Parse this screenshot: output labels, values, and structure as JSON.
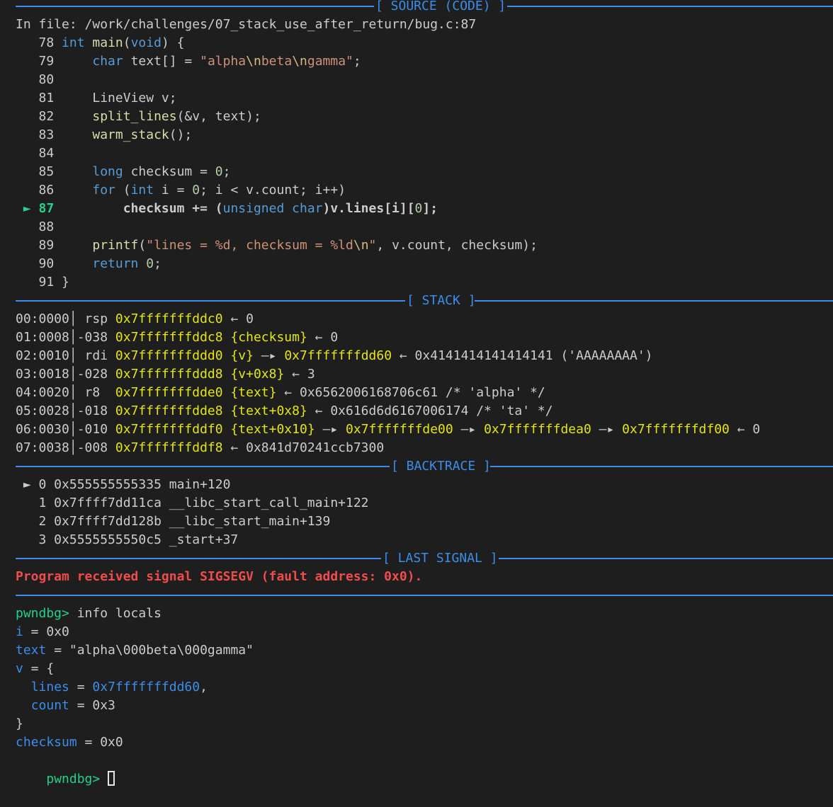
{
  "colors": {
    "background": "#1e1e1e",
    "foreground": "#cccccc",
    "separator": "#3b8eea",
    "keyword": "#569cd6",
    "function": "#dcdcaa",
    "string": "#ce9178",
    "escape": "#d7ba7d",
    "number": "#b5cea8",
    "address": "#e5e510",
    "pointer_target": "#e5e510",
    "signal": "#f14c4c",
    "prompt": "#23d18b",
    "variable": "#3b8eea",
    "current_line": "#23d18b"
  },
  "sections": {
    "source": "[ SOURCE (CODE) ]",
    "stack": "[ STACK ]",
    "backtrace": "[ BACKTRACE ]",
    "last_signal": "[ LAST SIGNAL ]"
  },
  "source": {
    "file_line": "In file: /work/challenges/07_stack_use_after_return/bug.c:87",
    "current_marker": "►",
    "lines": [
      [
        {
          "t": "   78 ",
          "c": "foreground"
        },
        {
          "t": "int",
          "c": "keyword"
        },
        {
          "t": " ",
          "c": "foreground"
        },
        {
          "t": "main",
          "c": "function"
        },
        {
          "t": "(",
          "c": "foreground"
        },
        {
          "t": "void",
          "c": "keyword"
        },
        {
          "t": ") {",
          "c": "foreground"
        }
      ],
      [
        {
          "t": "   79     ",
          "c": "foreground"
        },
        {
          "t": "char",
          "c": "keyword"
        },
        {
          "t": " text[] = ",
          "c": "foreground"
        },
        {
          "t": "\"alpha",
          "c": "string"
        },
        {
          "t": "\\n",
          "c": "escape"
        },
        {
          "t": "beta",
          "c": "string"
        },
        {
          "t": "\\n",
          "c": "escape"
        },
        {
          "t": "gamma\"",
          "c": "string"
        },
        {
          "t": ";",
          "c": "foreground"
        }
      ],
      [
        {
          "t": "   80",
          "c": "foreground"
        }
      ],
      [
        {
          "t": "   81     LineView v;",
          "c": "foreground"
        }
      ],
      [
        {
          "t": "   82     ",
          "c": "foreground"
        },
        {
          "t": "split_lines",
          "c": "function"
        },
        {
          "t": "(&v, text);",
          "c": "foreground"
        }
      ],
      [
        {
          "t": "   83     ",
          "c": "foreground"
        },
        {
          "t": "warm_stack",
          "c": "function"
        },
        {
          "t": "();",
          "c": "foreground"
        }
      ],
      [
        {
          "t": "   84",
          "c": "foreground"
        }
      ],
      [
        {
          "t": "   85     ",
          "c": "foreground"
        },
        {
          "t": "long",
          "c": "keyword"
        },
        {
          "t": " checksum = ",
          "c": "foreground"
        },
        {
          "t": "0",
          "c": "number"
        },
        {
          "t": ";",
          "c": "foreground"
        }
      ],
      [
        {
          "t": "   86     ",
          "c": "foreground"
        },
        {
          "t": "for",
          "c": "keyword"
        },
        {
          "t": " (",
          "c": "foreground"
        },
        {
          "t": "int",
          "c": "keyword"
        },
        {
          "t": " i = ",
          "c": "foreground"
        },
        {
          "t": "0",
          "c": "number"
        },
        {
          "t": "; i < v.count; i++)",
          "c": "foreground"
        }
      ],
      [
        {
          "t": " ► 87         ",
          "c": "current_line"
        },
        {
          "t": "checksum += (",
          "c": "foreground"
        },
        {
          "t": "unsigned char",
          "c": "keyword"
        },
        {
          "t": ")v.lines[i][",
          "c": "foreground"
        },
        {
          "t": "0",
          "c": "number"
        },
        {
          "t": "];",
          "c": "foreground"
        }
      ],
      [
        {
          "t": "   88",
          "c": "foreground"
        }
      ],
      [
        {
          "t": "   89     ",
          "c": "foreground"
        },
        {
          "t": "printf",
          "c": "function"
        },
        {
          "t": "(",
          "c": "foreground"
        },
        {
          "t": "\"lines = %d, checksum = %ld",
          "c": "string"
        },
        {
          "t": "\\n",
          "c": "escape"
        },
        {
          "t": "\"",
          "c": "string"
        },
        {
          "t": ", v.count, checksum);",
          "c": "foreground"
        }
      ],
      [
        {
          "t": "   90     ",
          "c": "foreground"
        },
        {
          "t": "return",
          "c": "keyword"
        },
        {
          "t": " ",
          "c": "foreground"
        },
        {
          "t": "0",
          "c": "number"
        },
        {
          "t": ";",
          "c": "foreground"
        }
      ],
      [
        {
          "t": "   91 }",
          "c": "foreground"
        }
      ]
    ]
  },
  "stack": [
    [
      {
        "t": "00:0000│ rsp ",
        "c": "foreground"
      },
      {
        "t": "0x7fffffffddc0",
        "c": "address"
      },
      {
        "t": " ← 0",
        "c": "foreground"
      }
    ],
    [
      {
        "t": "01:0008│-038 ",
        "c": "foreground"
      },
      {
        "t": "0x7fffffffddc8 {checksum}",
        "c": "address"
      },
      {
        "t": " ← 0",
        "c": "foreground"
      }
    ],
    [
      {
        "t": "02:0010│ rdi ",
        "c": "foreground"
      },
      {
        "t": "0x7fffffffddd0 {v}",
        "c": "address"
      },
      {
        "t": " —▸ ",
        "c": "foreground"
      },
      {
        "t": "0x7fffffffdd60",
        "c": "address"
      },
      {
        "t": " ← 0x4141414141414141 ('AAAAAAAA')",
        "c": "foreground"
      }
    ],
    [
      {
        "t": "03:0018│-028 ",
        "c": "foreground"
      },
      {
        "t": "0x7fffffffddd8 {v+0x8}",
        "c": "address"
      },
      {
        "t": " ← 3",
        "c": "foreground"
      }
    ],
    [
      {
        "t": "04:0020│ r8  ",
        "c": "foreground"
      },
      {
        "t": "0x7fffffffdde0 {text}",
        "c": "address"
      },
      {
        "t": " ← 0x6562006168706c61 /* 'alpha' */",
        "c": "foreground"
      }
    ],
    [
      {
        "t": "05:0028│-018 ",
        "c": "foreground"
      },
      {
        "t": "0x7fffffffdde8 {text+0x8}",
        "c": "address"
      },
      {
        "t": " ← 0x616d6d6167006174 /* 'ta' */",
        "c": "foreground"
      }
    ],
    [
      {
        "t": "06:0030│-010 ",
        "c": "foreground"
      },
      {
        "t": "0x7fffffffddf0 {text+0x10}",
        "c": "address"
      },
      {
        "t": " —▸ ",
        "c": "foreground"
      },
      {
        "t": "0x7fffffffde00",
        "c": "address"
      },
      {
        "t": " —▸ ",
        "c": "foreground"
      },
      {
        "t": "0x7fffffffdea0",
        "c": "address"
      },
      {
        "t": " —▸ ",
        "c": "foreground"
      },
      {
        "t": "0x7fffffffdf00",
        "c": "address"
      },
      {
        "t": " ← 0",
        "c": "foreground"
      }
    ],
    [
      {
        "t": "07:0038│-008 ",
        "c": "foreground"
      },
      {
        "t": "0x7fffffffddf8",
        "c": "address"
      },
      {
        "t": " ← 0x841d70241ccb7300",
        "c": "foreground"
      }
    ]
  ],
  "backtrace": [
    " ► 0 0x555555555335 main+120",
    "   1 0x7ffff7dd11ca __libc_start_call_main+122",
    "   2 0x7ffff7dd128b __libc_start_main+139",
    "   3 0x5555555550c5 _start+37"
  ],
  "signal": "Program received signal SIGSEGV (fault address: 0x0).",
  "console": [
    [
      {
        "t": "pwndbg>",
        "c": "prompt"
      },
      {
        "t": " info locals",
        "c": "foreground"
      }
    ],
    [
      {
        "t": "i",
        "c": "variable"
      },
      {
        "t": " = 0x0",
        "c": "foreground"
      }
    ],
    [
      {
        "t": "text",
        "c": "variable"
      },
      {
        "t": " = \"alpha\\000beta\\000gamma\"",
        "c": "foreground"
      }
    ],
    [
      {
        "t": "v",
        "c": "variable"
      },
      {
        "t": " = {",
        "c": "foreground"
      }
    ],
    [
      {
        "t": "  ",
        "c": "foreground"
      },
      {
        "t": "lines",
        "c": "variable"
      },
      {
        "t": " = ",
        "c": "foreground"
      },
      {
        "t": "0x7fffffffdd60",
        "c": "variable"
      },
      {
        "t": ",",
        "c": "foreground"
      }
    ],
    [
      {
        "t": "  ",
        "c": "foreground"
      },
      {
        "t": "count",
        "c": "variable"
      },
      {
        "t": " = 0x3",
        "c": "foreground"
      }
    ],
    [
      {
        "t": "}",
        "c": "foreground"
      }
    ],
    [
      {
        "t": "checksum",
        "c": "variable"
      },
      {
        "t": " = 0x0",
        "c": "foreground"
      }
    ]
  ],
  "prompt": {
    "label": "pwndbg>",
    "input": ""
  }
}
